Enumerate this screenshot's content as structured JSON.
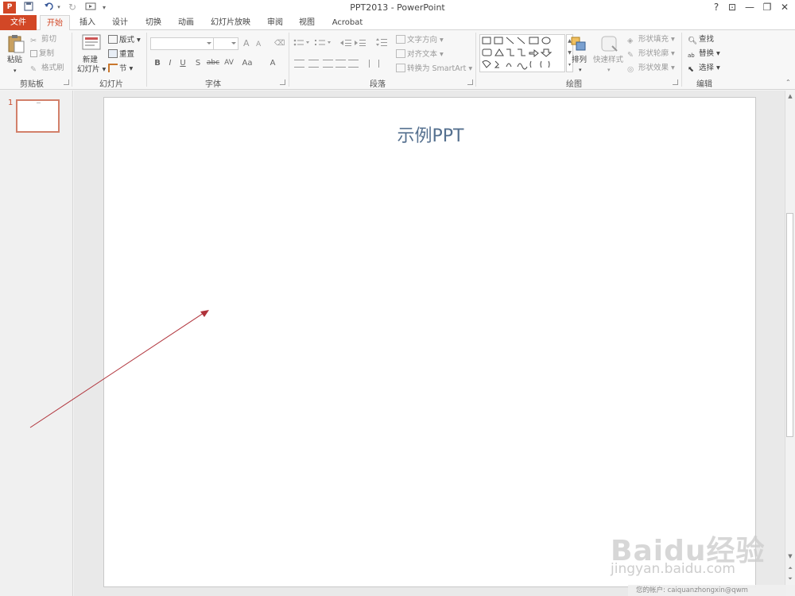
{
  "window": {
    "title": "PPT2013 - PowerPoint",
    "help": "?",
    "controls": [
      "⊡",
      "—",
      "❐",
      "✕"
    ]
  },
  "qat": {
    "undo_caret": "▾",
    "more": "▾"
  },
  "tabs": [
    "文件",
    "开始",
    "插入",
    "设计",
    "切换",
    "动画",
    "幻灯片放映",
    "审阅",
    "视图",
    "Acrobat"
  ],
  "ribbon": {
    "clipboard": {
      "paste": "粘贴",
      "cut": "剪切",
      "copy": "复制",
      "format_painter": "格式刷",
      "label": "剪贴板"
    },
    "slides": {
      "new_slide_1": "新建",
      "new_slide_2": "幻灯片",
      "layout": "版式",
      "reset": "重置",
      "section": "节",
      "label": "幻灯片"
    },
    "font": {
      "bold": "B",
      "italic": "I",
      "underline": "U",
      "shadow": "S",
      "strike": "abc",
      "spacing": "AV",
      "case": "Aa",
      "color": "A",
      "grow": "A",
      "shrink": "A",
      "label": "字体"
    },
    "paragraph": {
      "text_direction": "文字方向",
      "align_text": "对齐文本",
      "smartart": "转换为 SmartArt",
      "label": "段落"
    },
    "drawing": {
      "arrange": "排列",
      "quick_styles": "快速样式",
      "shape_fill": "形状填充",
      "shape_outline": "形状轮廓",
      "shape_effects": "形状效果",
      "label": "绘图"
    },
    "editing": {
      "find": "查找",
      "replace": "替换",
      "select": "选择",
      "label": "编辑"
    }
  },
  "slides_pane": {
    "number": "1"
  },
  "slide": {
    "title": "示例PPT"
  },
  "watermark": {
    "logo": "Baidu经验",
    "url": "jingyan.baidu.com"
  },
  "status": {
    "text": "您的帐户: caiquanzhongxin@qwm"
  },
  "colors": {
    "accent": "#d24726",
    "title_text": "#55708f",
    "arrow": "#b0323a"
  }
}
